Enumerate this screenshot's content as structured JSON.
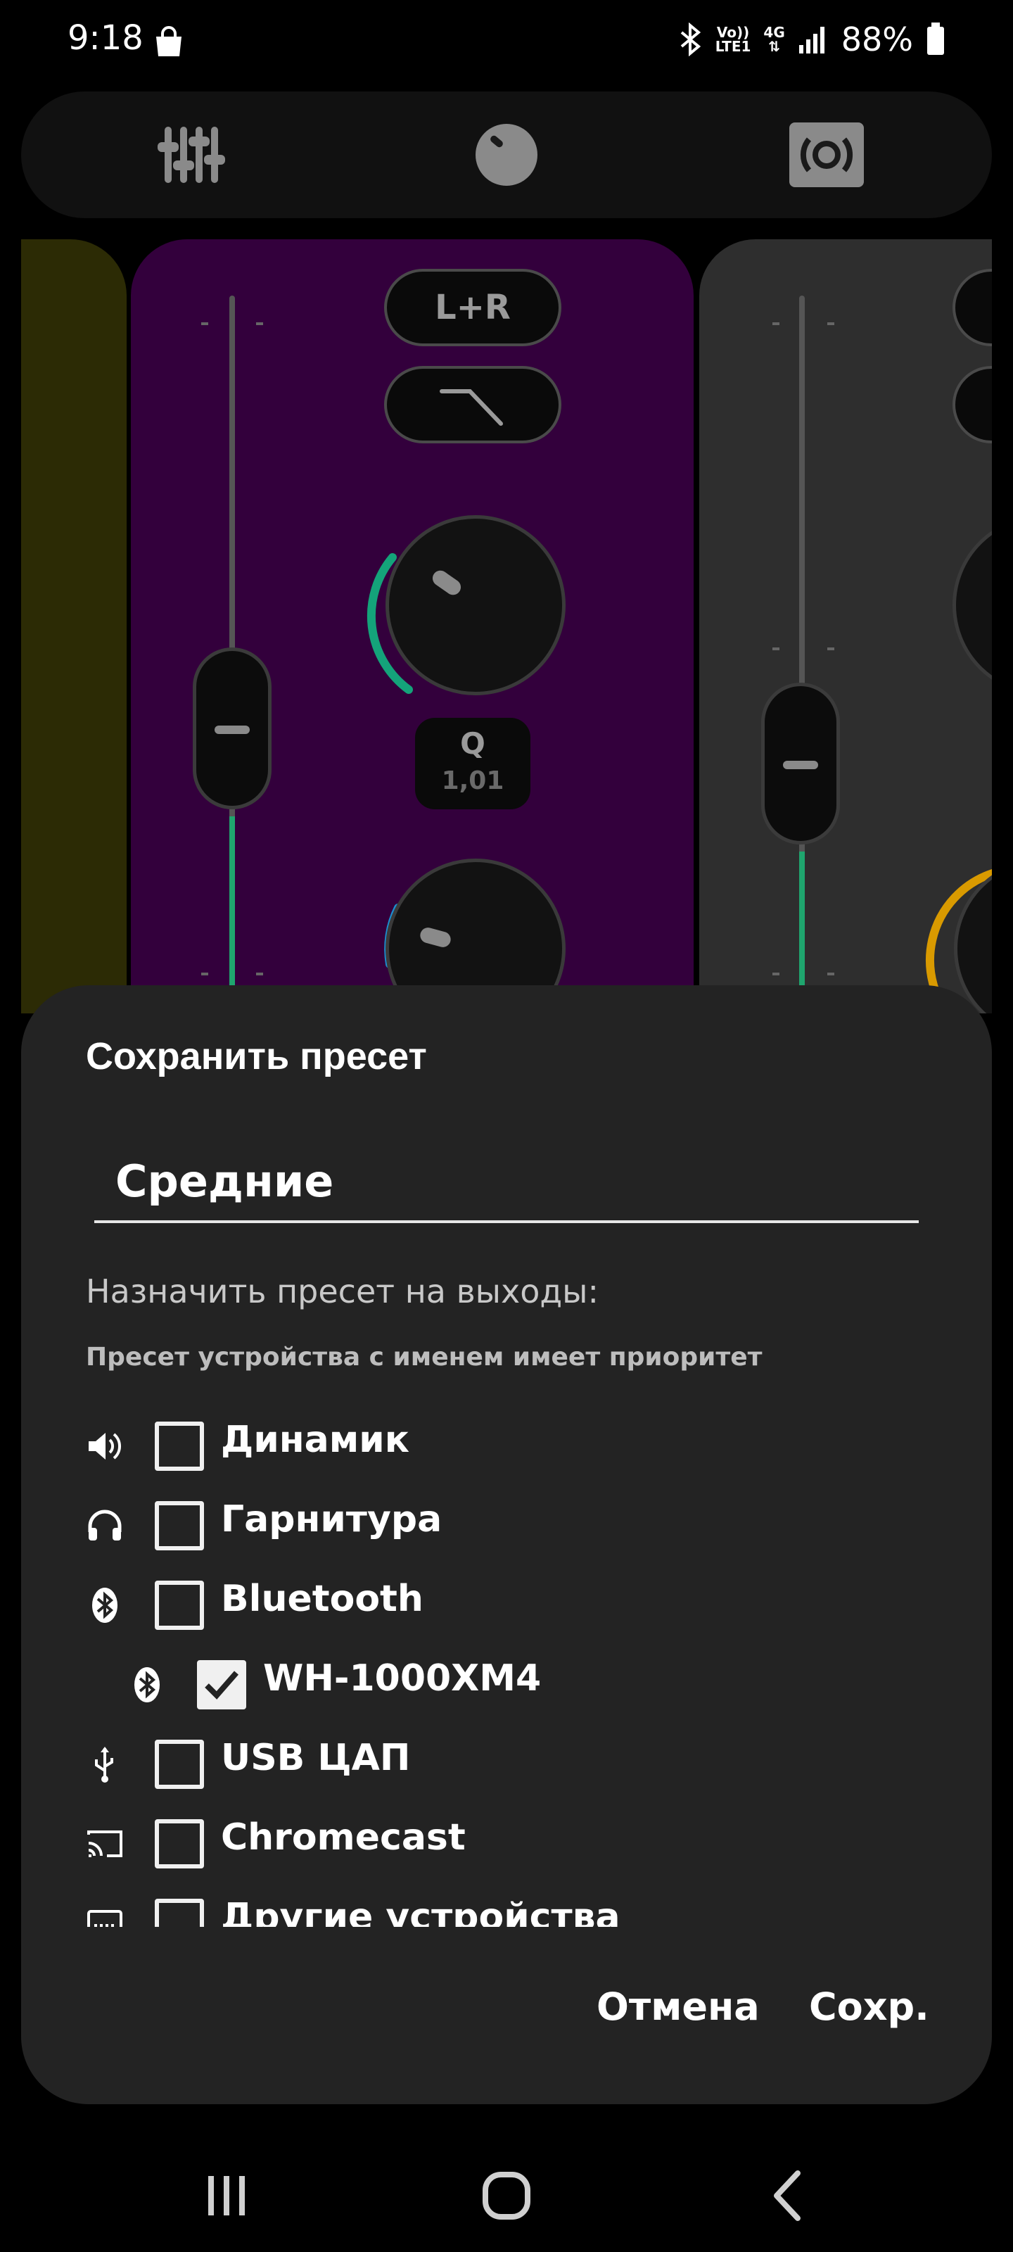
{
  "status_bar": {
    "time": "9:18",
    "network_top": "Vo))",
    "network_bottom": "LTE1",
    "network_type": "4G",
    "battery": "88%"
  },
  "toolbar": {
    "icons": [
      "equalizer-icon",
      "knob-icon",
      "speaker-output-icon"
    ]
  },
  "mixer": {
    "channel_mode": "L+R",
    "filter_icon": "low-pass-filter-icon",
    "q_label": "Q",
    "q_value": "1,01"
  },
  "dialog": {
    "title": "Сохранить пресет",
    "name_value": "Средние",
    "assign_label": "Назначить пресет на выходы:",
    "priority_note": "Пресет устройства с именем имеет приоритет",
    "outputs": [
      {
        "label": "Динамик",
        "icon": "speaker-icon",
        "checked": false
      },
      {
        "label": "Гарнитура",
        "icon": "headphones-icon",
        "checked": false
      },
      {
        "label": "Bluetooth",
        "icon": "bluetooth-icon",
        "checked": false
      },
      {
        "label": "WH-1000XM4",
        "icon": "bluetooth-icon",
        "checked": true
      },
      {
        "label": "USB ЦАП",
        "icon": "usb-icon",
        "checked": false
      },
      {
        "label": "Chromecast",
        "icon": "cast-icon",
        "checked": false
      },
      {
        "label": "Другие устройства",
        "icon": "other-device-icon",
        "checked": false
      }
    ],
    "cancel_label": "Отмена",
    "save_label": "Сохр."
  },
  "colors": {
    "accent_green": "#1fa56e",
    "accent_blue": "#1a8fd0",
    "accent_amber": "#d99a00",
    "strip_purple": "#33003c"
  }
}
